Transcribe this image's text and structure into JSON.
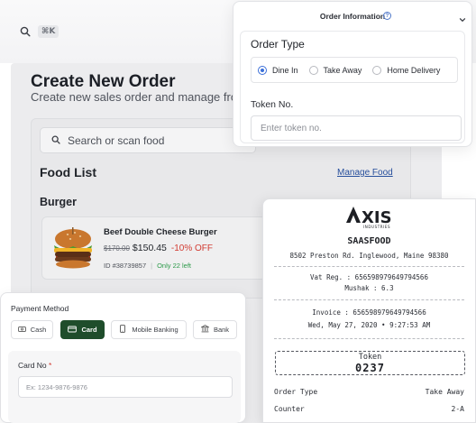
{
  "topbar": {
    "shortcut": "⌘K"
  },
  "page": {
    "title": "Create New Order",
    "subtitle": "Create new sales order and manage from"
  },
  "food": {
    "search_placeholder": "Search or scan food",
    "list_title": "Food List",
    "manage_link": "Manage Food",
    "category": "Burger",
    "product": {
      "name": "Beef Double Cheese Burger",
      "old_price": "$170.00",
      "new_price": "$150.45",
      "discount": "-10% OFF",
      "id": "ID #38739857",
      "stock": "Only 22 left"
    }
  },
  "order_info": {
    "title": "Order Information",
    "order_type_label": "Order Type",
    "options": [
      "Dine In",
      "Take Away",
      "Home Delivery"
    ],
    "selected": "Dine In",
    "token_label": "Token No.",
    "token_placeholder": "Enter token no."
  },
  "payment": {
    "title": "Payment Method",
    "methods": [
      {
        "label": "Cash",
        "icon": "cash-icon"
      },
      {
        "label": "Card",
        "icon": "card-icon"
      },
      {
        "label": "Mobile Banking",
        "icon": "mobile-banking-icon"
      },
      {
        "label": "Bank",
        "icon": "bank-icon"
      }
    ],
    "active_method": "Card",
    "card_label": "Card No",
    "required_mark": "*",
    "card_placeholder": "Ex: 1234-9876-9876"
  },
  "receipt": {
    "logo_text": "AXIS",
    "logo_sub": "INDUSTRIES",
    "store": "SAASFOOD",
    "address": "8502 Preston Rd. Inglewood, Maine 98380",
    "vat_reg": "Vat Reg. : 656598979649794566",
    "mushak": "Mushak : 6.3",
    "invoice": "Invoice : 656598979649794566",
    "datetime": "Wed, May 27, 2020 • 9:27:53 AM",
    "token_title": "Token",
    "token_value": "0237",
    "rows": [
      {
        "label": "Order Type",
        "value": "Take Away"
      },
      {
        "label": "Counter",
        "value": "2-A"
      }
    ]
  },
  "colors": {
    "accent_green": "#1f4d2b",
    "radio_blue": "#3b6fd8",
    "link_blue": "#274f9c",
    "discount_red": "#d23b32",
    "stock_green": "#2d9a4a"
  }
}
